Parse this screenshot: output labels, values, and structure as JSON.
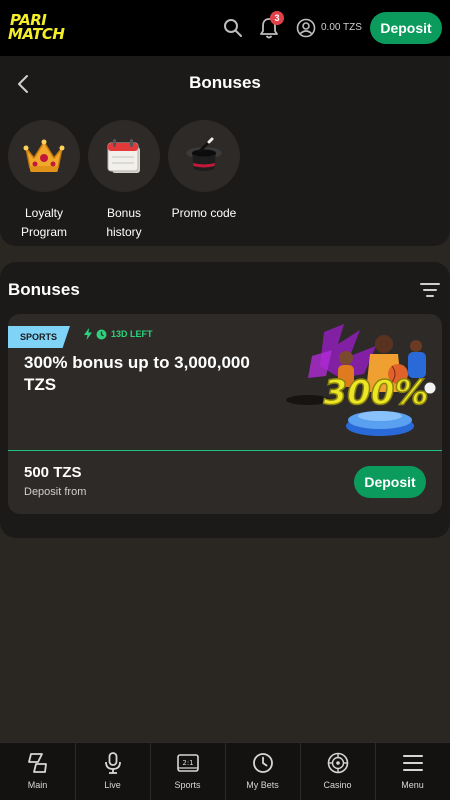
{
  "header": {
    "logo_line1": "PARI",
    "logo_line2": "MATCH",
    "notifications_count": "3",
    "balance": "0.00 TZS",
    "deposit_label": "Deposit",
    "accent_color": "#0b9b5d",
    "logo_color": "#f4ee2a"
  },
  "page": {
    "title": "Bonuses"
  },
  "shortcuts": [
    {
      "label": "Loyalty Program",
      "icon": "crown-icon"
    },
    {
      "label": "Bonus history",
      "icon": "calendar-icon"
    },
    {
      "label": "Promo code",
      "icon": "magic-hat-icon"
    }
  ],
  "bonuses_section": {
    "heading": "Bonuses",
    "card": {
      "tag": "SPORTS",
      "timer": "13D LEFT",
      "title": "300% bonus up to 3,000,000 TZS",
      "art_text": "300%",
      "amount": "500 TZS",
      "amount_caption": "Deposit from",
      "deposit_label": "Deposit"
    }
  },
  "bottom_nav": [
    {
      "label": "Main",
      "icon": "main-icon"
    },
    {
      "label": "Live",
      "icon": "microphone-icon"
    },
    {
      "label": "Sports",
      "icon": "scoreboard-icon"
    },
    {
      "label": "My Bets",
      "icon": "clock-icon"
    },
    {
      "label": "Casino",
      "icon": "roulette-icon"
    },
    {
      "label": "Menu",
      "icon": "hamburger-icon"
    }
  ]
}
